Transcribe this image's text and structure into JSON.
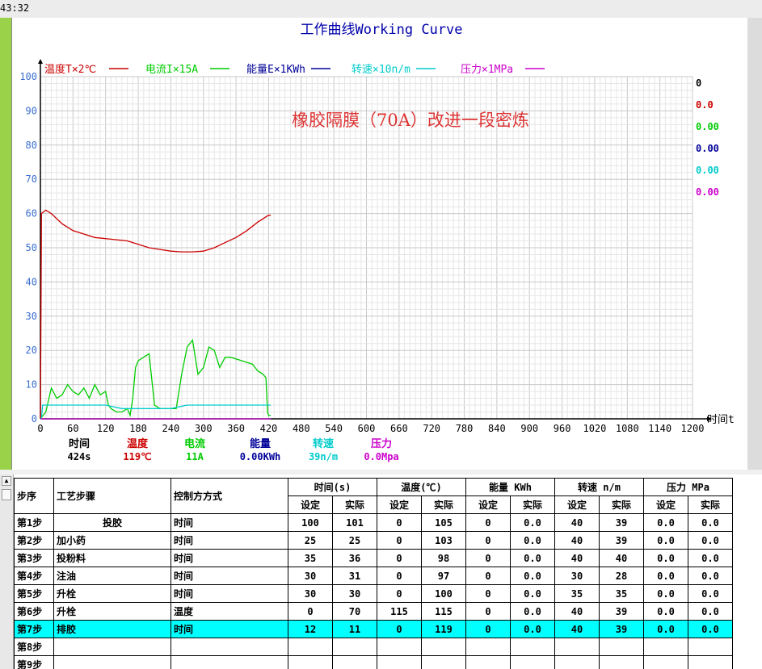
{
  "clock": "43:32",
  "chart": {
    "title": "工作曲线Working Curve",
    "annotation": "橡胶隔膜（70A）改进一段密炼",
    "x_axis_label": "时间t",
    "legend": [
      {
        "label": "温度T×2℃",
        "color": "#cc0000"
      },
      {
        "label": "电流I×15A",
        "color": "#00cc00"
      },
      {
        "label": "能量E×1KWh",
        "color": "#000099"
      },
      {
        "label": "转速×10n/m",
        "color": "#00cccc"
      },
      {
        "label": "压力×1MPa",
        "color": "#cc00cc"
      }
    ],
    "right_values": [
      {
        "text": "0",
        "color": "#000000"
      },
      {
        "text": "0.0",
        "color": "#cc0000"
      },
      {
        "text": "0.00",
        "color": "#00cc00"
      },
      {
        "text": "0.00",
        "color": "#000099"
      },
      {
        "text": "0.00",
        "color": "#00cccc"
      },
      {
        "text": "0.00",
        "color": "#cc00cc"
      }
    ],
    "readouts": [
      {
        "label": "时间",
        "value": "424s",
        "color": "#000000"
      },
      {
        "label": "温度",
        "value": "119℃",
        "color": "#cc0000"
      },
      {
        "label": "电流",
        "value": "11A",
        "color": "#00cc00"
      },
      {
        "label": "能量",
        "value": "0.00KWh",
        "color": "#000099"
      },
      {
        "label": "转速",
        "value": "39n/m",
        "color": "#00cccc"
      },
      {
        "label": "压力",
        "value": "0.0Mpa",
        "color": "#cc00cc"
      }
    ]
  },
  "chart_data": {
    "type": "line",
    "xlim": [
      0,
      1200
    ],
    "ylim": [
      0,
      100
    ],
    "x_ticks": [
      0,
      60,
      120,
      180,
      240,
      300,
      360,
      420,
      480,
      540,
      600,
      660,
      720,
      780,
      840,
      900,
      960,
      1020,
      1080,
      1140,
      1200
    ],
    "y_ticks": [
      0,
      10,
      20,
      30,
      40,
      50,
      60,
      70,
      80,
      90,
      100
    ],
    "grid": true,
    "series": [
      {
        "name": "温度T×2℃",
        "color": "#cc0000",
        "points": [
          [
            0,
            0
          ],
          [
            1,
            30
          ],
          [
            2,
            60
          ],
          [
            10,
            61
          ],
          [
            20,
            60
          ],
          [
            40,
            57
          ],
          [
            60,
            55
          ],
          [
            80,
            54
          ],
          [
            100,
            53
          ],
          [
            130,
            52.5
          ],
          [
            160,
            52
          ],
          [
            180,
            51
          ],
          [
            200,
            50
          ],
          [
            220,
            49.5
          ],
          [
            240,
            49
          ],
          [
            260,
            48.8
          ],
          [
            280,
            48.8
          ],
          [
            300,
            49
          ],
          [
            320,
            50
          ],
          [
            340,
            51.5
          ],
          [
            360,
            53
          ],
          [
            380,
            55
          ],
          [
            400,
            57.5
          ],
          [
            420,
            59.5
          ],
          [
            424,
            59.5
          ]
        ]
      },
      {
        "name": "电流I×15A",
        "color": "#00cc00",
        "points": [
          [
            0,
            0
          ],
          [
            10,
            2
          ],
          [
            20,
            9
          ],
          [
            30,
            6
          ],
          [
            40,
            7
          ],
          [
            50,
            10
          ],
          [
            60,
            8
          ],
          [
            70,
            7
          ],
          [
            80,
            9
          ],
          [
            90,
            6
          ],
          [
            100,
            10
          ],
          [
            110,
            7
          ],
          [
            120,
            8
          ],
          [
            125,
            4
          ],
          [
            130,
            3
          ],
          [
            140,
            2
          ],
          [
            150,
            2
          ],
          [
            160,
            3
          ],
          [
            165,
            1
          ],
          [
            170,
            6
          ],
          [
            175,
            15
          ],
          [
            180,
            17
          ],
          [
            190,
            18
          ],
          [
            200,
            19
          ],
          [
            210,
            4
          ],
          [
            220,
            3
          ],
          [
            230,
            3
          ],
          [
            240,
            3
          ],
          [
            250,
            3
          ],
          [
            260,
            13
          ],
          [
            270,
            21
          ],
          [
            280,
            23
          ],
          [
            290,
            13
          ],
          [
            300,
            15
          ],
          [
            310,
            21
          ],
          [
            320,
            20
          ],
          [
            330,
            15
          ],
          [
            340,
            18
          ],
          [
            350,
            18
          ],
          [
            370,
            17
          ],
          [
            390,
            16
          ],
          [
            400,
            14
          ],
          [
            410,
            13
          ],
          [
            415,
            12
          ],
          [
            418,
            2
          ],
          [
            420,
            1
          ],
          [
            424,
            1
          ]
        ]
      },
      {
        "name": "转速×10n/m",
        "color": "#00cccc",
        "points": [
          [
            0,
            0
          ],
          [
            2,
            0
          ],
          [
            4,
            4
          ],
          [
            120,
            4
          ],
          [
            150,
            3
          ],
          [
            180,
            3
          ],
          [
            240,
            3
          ],
          [
            270,
            4
          ],
          [
            420,
            4
          ],
          [
            424,
            4
          ]
        ]
      },
      {
        "name": "压力×1MPa",
        "color": "#cc00cc",
        "points": [
          [
            0,
            0
          ],
          [
            424,
            0
          ]
        ]
      }
    ]
  },
  "table": {
    "headers": {
      "step": "步序",
      "process": "工艺步骤",
      "control": "控制方方式",
      "groups": [
        "时间(s)",
        "温度(℃)",
        "能量 KWh",
        "转速 n/m",
        "压力 MPa"
      ],
      "set": "设定",
      "actual": "实际"
    },
    "rows": [
      [
        "第1步",
        "投胶",
        "时间",
        "100",
        "101",
        "0",
        "105",
        "0",
        "0.0",
        "40",
        "39",
        "0.0",
        "0.0"
      ],
      [
        "第2步",
        "加小药",
        "时间",
        "25",
        "25",
        "0",
        "103",
        "0",
        "0.0",
        "40",
        "39",
        "0.0",
        "0.0"
      ],
      [
        "第3步",
        "投粉料",
        "时间",
        "35",
        "36",
        "0",
        "98",
        "0",
        "0.0",
        "40",
        "40",
        "0.0",
        "0.0"
      ],
      [
        "第4步",
        "注油",
        "时间",
        "30",
        "31",
        "0",
        "97",
        "0",
        "0.0",
        "30",
        "28",
        "0.0",
        "0.0"
      ],
      [
        "第5步",
        "升栓",
        "时间",
        "30",
        "30",
        "0",
        "100",
        "0",
        "0.0",
        "35",
        "35",
        "0.0",
        "0.0"
      ],
      [
        "第6步",
        "升栓",
        "温度",
        "0",
        "70",
        "115",
        "115",
        "0",
        "0.0",
        "40",
        "39",
        "0.0",
        "0.0"
      ],
      [
        "第7步",
        "排胶",
        "时间",
        "12",
        "11",
        "0",
        "119",
        "0",
        "0.0",
        "40",
        "39",
        "0.0",
        "0.0"
      ],
      [
        "第8步",
        "",
        "",
        "",
        "",
        "",
        "",
        "",
        "",
        "",
        "",
        "",
        ""
      ],
      [
        "第9步",
        "",
        "",
        "",
        "",
        "",
        "",
        "",
        "",
        "",
        "",
        "",
        ""
      ]
    ],
    "highlight_row": 6
  }
}
